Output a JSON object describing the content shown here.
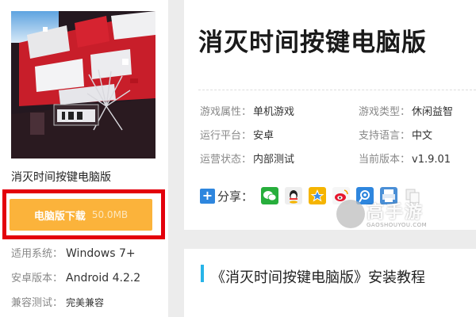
{
  "game": {
    "name": "消灭时间按键电脑版"
  },
  "download": {
    "label": "电脑版下载",
    "size": "50.0MB"
  },
  "left_meta": [
    {
      "key": "适用系统：",
      "value": "Windows 7+"
    },
    {
      "key": "安卓版本：",
      "value": "Android 4.2.2"
    },
    {
      "key": "兼容测试：",
      "value": "完美兼容"
    }
  ],
  "info": {
    "title": "消灭时间按键电脑版",
    "attrs": [
      {
        "key": "游戏属性：",
        "value": "单机游戏"
      },
      {
        "key": "游戏类型：",
        "value": "休闲益智"
      },
      {
        "key": "运行平台：",
        "value": "安卓"
      },
      {
        "key": "支持语言：",
        "value": "中文"
      },
      {
        "key": "运营状态：",
        "value": "内部测试"
      },
      {
        "key": "当前版本：",
        "value": "v1.9.01"
      }
    ]
  },
  "share": {
    "label": "分享：",
    "icons": [
      "wechat-icon",
      "qq-icon",
      "qzone-icon",
      "weibo-icon",
      "tencent-weibo-icon",
      "print-icon",
      "copy-icon"
    ],
    "colors": [
      "#27ae3c",
      "#e9e9e9",
      "#f5b400",
      "#f6f6f6",
      "#2e86de",
      "#4a8fd6",
      "#cfcfcf"
    ]
  },
  "watermark": {
    "brand": "高手游",
    "domain": "GAOSHOUYOU.COM"
  },
  "tutorial": {
    "title": "《消灭时间按键电脑版》安装教程"
  },
  "colors": {
    "download_button": "#fbb33b",
    "highlight_frame": "#e3000c",
    "section_bar": "#27b4e8",
    "cover_red": "#d8202a"
  }
}
